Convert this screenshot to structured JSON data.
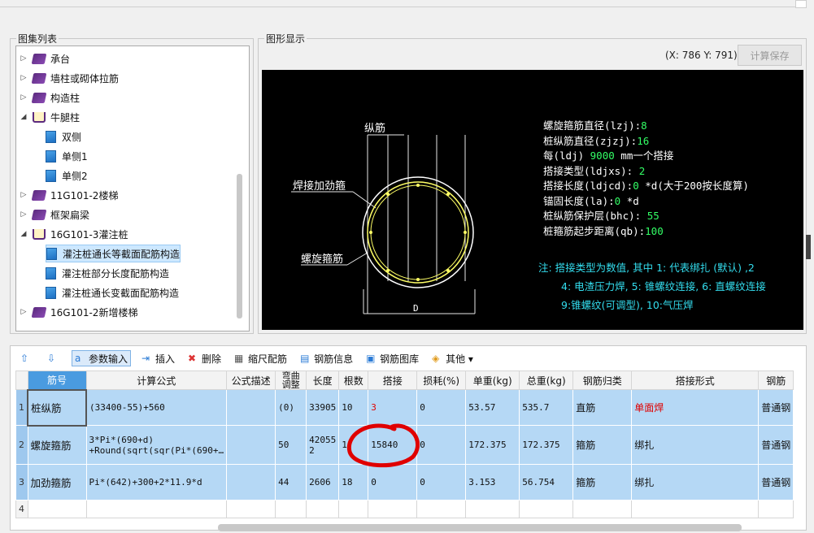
{
  "panels": {
    "atlas_title": "图集列表",
    "figure_title": "图形显示"
  },
  "tree": [
    {
      "label": "承台",
      "type": "book",
      "indent": 0,
      "expanded": false
    },
    {
      "label": "墙柱或砌体拉筋",
      "type": "book",
      "indent": 0,
      "expanded": false
    },
    {
      "label": "构造柱",
      "type": "book",
      "indent": 0,
      "expanded": false
    },
    {
      "label": "牛腿柱",
      "type": "openbook",
      "indent": 0,
      "expanded": true
    },
    {
      "label": "双侧",
      "type": "page",
      "indent": 1
    },
    {
      "label": "单侧1",
      "type": "page",
      "indent": 1
    },
    {
      "label": "单侧2",
      "type": "page",
      "indent": 1
    },
    {
      "label": "11G101-2楼梯",
      "type": "book",
      "indent": 0,
      "expanded": false
    },
    {
      "label": "框架扁梁",
      "type": "book",
      "indent": 0,
      "expanded": false
    },
    {
      "label": "16G101-3灌注桩",
      "type": "openbook",
      "indent": 0,
      "expanded": true
    },
    {
      "label": "灌注桩通长等截面配筋构造",
      "type": "page",
      "indent": 1,
      "selected": true
    },
    {
      "label": "灌注桩部分长度配筋构造",
      "type": "page",
      "indent": 1
    },
    {
      "label": "灌注桩通长变截面配筋构造",
      "type": "page",
      "indent": 1
    },
    {
      "label": "16G101-2新增楼梯",
      "type": "book",
      "indent": 0,
      "expanded": false
    }
  ],
  "figure": {
    "coords": "(X: 786 Y: 791)",
    "calc_save": "计算保存",
    "labels": {
      "zongjin": "纵筋",
      "hanjie": "焊接加劲箍",
      "luoxuan": "螺旋箍筋",
      "d": "D"
    },
    "params": [
      {
        "label": "螺旋箍筋直径(lzj):",
        "value": "8",
        "suffix": ""
      },
      {
        "label": "桩纵筋直径(zjzj):",
        "value": "16",
        "suffix": ""
      },
      {
        "label": "每(ldj) ",
        "value": "9000",
        "suffix": " mm一个搭接"
      },
      {
        "label": "搭接类型(ldjxs):  ",
        "value": "2",
        "suffix": ""
      },
      {
        "label": "搭接长度(ldjcd):",
        "value": "0",
        "suffix": " *d(大于200按长度算)"
      },
      {
        "label": "锚固长度(la):",
        "value": "0",
        "suffix": "  *d"
      },
      {
        "label": "桩纵筋保护层(bhc): ",
        "value": "55",
        "suffix": ""
      },
      {
        "label": "桩箍筋起步距离(qb):",
        "value": "100",
        "suffix": ""
      }
    ],
    "note1": "注: 搭接类型为数值, 其中 1: 代表绑扎 (默认) ,2",
    "note2": "4: 电渣压力焊, 5: 锥螺纹连接, 6: 直螺纹连接",
    "note3": "9:锥螺纹(可调型), 10:气压焊"
  },
  "toolbar": [
    {
      "label": "",
      "icon": "up-arrow-icon"
    },
    {
      "label": "",
      "icon": "down-arrow-icon"
    },
    {
      "label": "参数输入",
      "icon": "param-icon",
      "active": true
    },
    {
      "label": "插入",
      "icon": "insert-icon"
    },
    {
      "label": "删除",
      "icon": "delete-icon"
    },
    {
      "label": "缩尺配筋",
      "icon": "scale-icon"
    },
    {
      "label": "钢筋信息",
      "icon": "info-icon"
    },
    {
      "label": "钢筋图库",
      "icon": "library-icon"
    },
    {
      "label": "其他 ▾",
      "icon": "other-icon"
    }
  ],
  "table": {
    "headers": [
      "筋号",
      "计算公式",
      "公式描述",
      "弯曲调整",
      "长度",
      "根数",
      "搭接",
      "损耗(%)",
      "单重(kg)",
      "总重(kg)",
      "钢筋归类",
      "搭接形式",
      "钢筋"
    ],
    "rows": [
      {
        "num": "1",
        "cells": [
          "桩纵筋",
          "(33400-55)+560",
          "",
          "(0)",
          "33905",
          "10",
          "3",
          "0",
          "53.57",
          "535.7",
          "直筋",
          "单面焊",
          "普通钢"
        ]
      },
      {
        "num": "2",
        "cells": [
          "螺旋箍筋",
          "3*Pi*(690+d)\n+Round(sqrt(sqr(Pi*(690+…",
          "",
          "50",
          "42055\n2",
          "1",
          "15840",
          "0",
          "172.375",
          "172.375",
          "箍筋",
          "绑扎",
          "普通钢"
        ]
      },
      {
        "num": "3",
        "cells": [
          "加劲箍筋",
          "Pi*(642)+300+2*11.9*d",
          "",
          "44",
          "2606",
          "18",
          "0",
          "0",
          "3.153",
          "56.754",
          "箍筋",
          "绑扎",
          "普通钢"
        ]
      },
      {
        "num": "4",
        "cells": [
          "",
          "",
          "",
          "",
          "",
          "",
          "",
          "",
          "",
          "",
          "",
          "",
          ""
        ]
      }
    ]
  },
  "colors": {
    "accent": "#4a9be0",
    "row": "#b5d8f5",
    "cad_yellow": "#ffff66",
    "cad_green": "#33ff66",
    "cad_cyan": "#33ddee",
    "annotation_red": "#e00000"
  }
}
